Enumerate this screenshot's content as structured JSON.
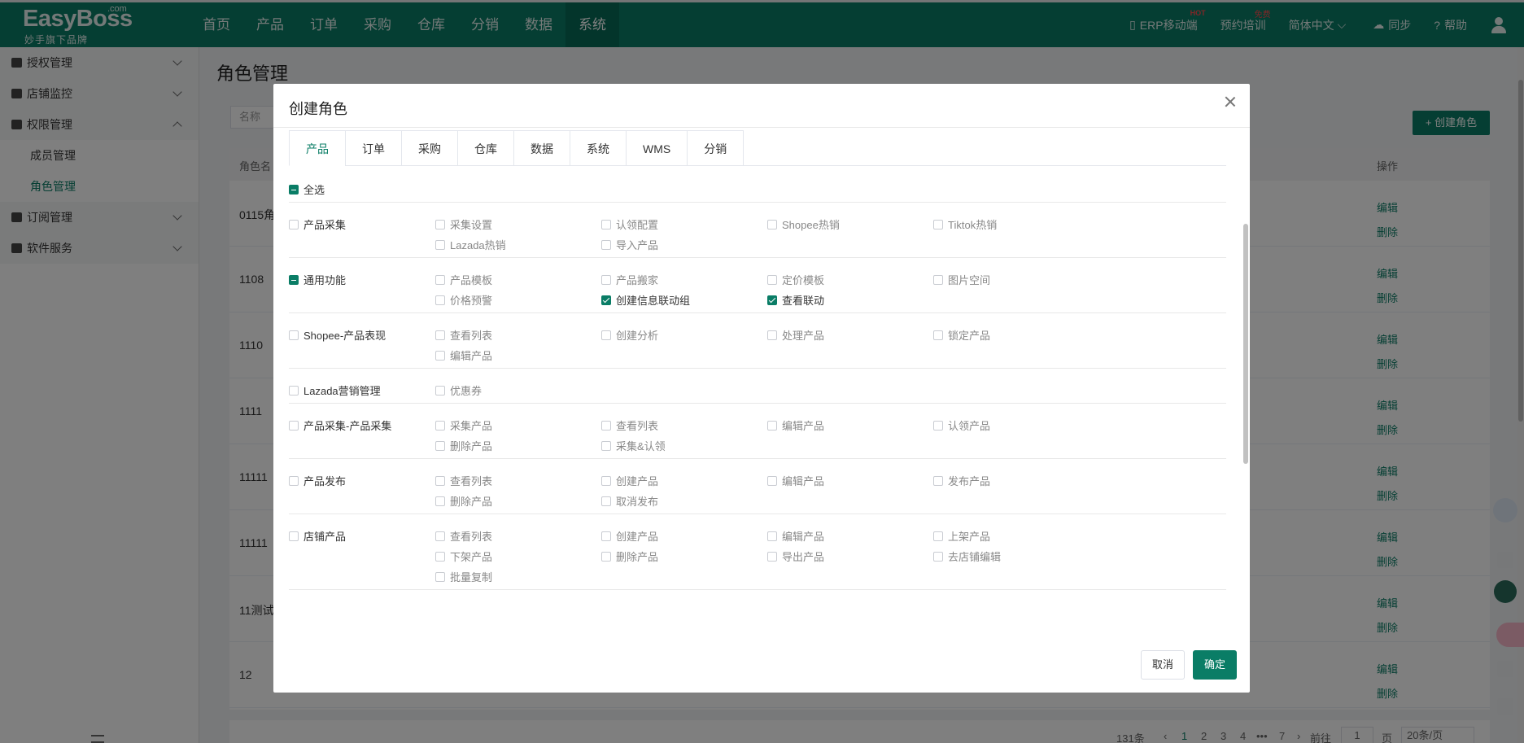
{
  "brand": {
    "name": "EasyBoss",
    "com": ".com",
    "sub": "妙手旗下品牌"
  },
  "nav": {
    "items": [
      "首页",
      "产品",
      "订单",
      "采购",
      "仓库",
      "分销",
      "数据",
      "系统"
    ],
    "active_index": 7,
    "right": {
      "mobile": "ERP移动端",
      "mobile_badge": "HOT",
      "training": "预约培训",
      "training_badge": "免费",
      "lang": "简体中文",
      "sync": "同步",
      "help": "帮助"
    }
  },
  "sidebar": {
    "groups": [
      {
        "label": "授权管理"
      },
      {
        "label": "店铺监控"
      },
      {
        "label": "权限管理",
        "children": [
          "成员管理",
          "角色管理"
        ],
        "active_child": 1
      },
      {
        "label": "订阅管理"
      },
      {
        "label": "软件服务"
      }
    ]
  },
  "page": {
    "title": "角色管理",
    "filter_placeholder": "名称",
    "create_button": "+ 创建角色",
    "table": {
      "col_name": "角色名",
      "col_action": "操作",
      "rows": [
        "0115角",
        "1108",
        "1110",
        "1111",
        "11111",
        "11111",
        "11测试",
        "12"
      ],
      "edit": "编辑",
      "delete": "删除"
    },
    "pager": {
      "total": "131条",
      "pages": [
        "1",
        "2",
        "3",
        "4",
        "•••",
        "7"
      ],
      "current": "1",
      "goto": "前往",
      "goto_value": "1",
      "page_unit": "页",
      "size": "20条/页"
    }
  },
  "modal": {
    "title": "创建角色",
    "tabs": [
      "产品",
      "订单",
      "采购",
      "仓库",
      "数据",
      "系统",
      "WMS",
      "分销"
    ],
    "active_tab": 0,
    "select_all": "全选",
    "rows": [
      {
        "group": "产品采集",
        "state": "none",
        "options": [
          {
            "label": "采集设置",
            "checked": false
          },
          {
            "label": "认领配置",
            "checked": false
          },
          {
            "label": "Shopee热销",
            "checked": false
          },
          {
            "label": "Tiktok热销",
            "checked": false
          },
          {
            "label": "Lazada热销",
            "checked": false
          },
          {
            "label": "导入产品",
            "checked": false
          }
        ]
      },
      {
        "group": "通用功能",
        "state": "partial",
        "options": [
          {
            "label": "产品模板",
            "checked": false
          },
          {
            "label": "产品搬家",
            "checked": false
          },
          {
            "label": "定价模板",
            "checked": false
          },
          {
            "label": "图片空间",
            "checked": false
          },
          {
            "label": "价格预警",
            "checked": false
          },
          {
            "label": "创建信息联动组",
            "checked": true
          },
          {
            "label": "查看联动",
            "checked": true
          }
        ]
      },
      {
        "group": "Shopee-产品表现",
        "state": "none",
        "options": [
          {
            "label": "查看列表",
            "checked": false
          },
          {
            "label": "创建分析",
            "checked": false
          },
          {
            "label": "处理产品",
            "checked": false
          },
          {
            "label": "锁定产品",
            "checked": false
          },
          {
            "label": "编辑产品",
            "checked": false
          }
        ]
      },
      {
        "group": "Lazada营销管理",
        "state": "none",
        "options": [
          {
            "label": "优惠券",
            "checked": false
          }
        ]
      },
      {
        "group": "产品采集-产品采集",
        "state": "none",
        "options": [
          {
            "label": "采集产品",
            "checked": false
          },
          {
            "label": "查看列表",
            "checked": false
          },
          {
            "label": "编辑产品",
            "checked": false
          },
          {
            "label": "认领产品",
            "checked": false
          },
          {
            "label": "删除产品",
            "checked": false
          },
          {
            "label": "采集&认领",
            "checked": false
          }
        ]
      },
      {
        "group": "产品发布",
        "state": "none",
        "options": [
          {
            "label": "查看列表",
            "checked": false
          },
          {
            "label": "创建产品",
            "checked": false
          },
          {
            "label": "编辑产品",
            "checked": false
          },
          {
            "label": "发布产品",
            "checked": false
          },
          {
            "label": "删除产品",
            "checked": false
          },
          {
            "label": "取消发布",
            "checked": false
          }
        ]
      },
      {
        "group": "店铺产品",
        "state": "none",
        "options": [
          {
            "label": "查看列表",
            "checked": false
          },
          {
            "label": "创建产品",
            "checked": false
          },
          {
            "label": "编辑产品",
            "checked": false
          },
          {
            "label": "上架产品",
            "checked": false
          },
          {
            "label": "下架产品",
            "checked": false
          },
          {
            "label": "删除产品",
            "checked": false
          },
          {
            "label": "导出产品",
            "checked": false
          },
          {
            "label": "去店铺编辑",
            "checked": false
          },
          {
            "label": "批量复制",
            "checked": false
          }
        ]
      }
    ],
    "cancel": "取消",
    "ok": "确定"
  },
  "colors": {
    "brand": "#0a7d66",
    "mask": "rgba(0,0,0,0.5)"
  }
}
